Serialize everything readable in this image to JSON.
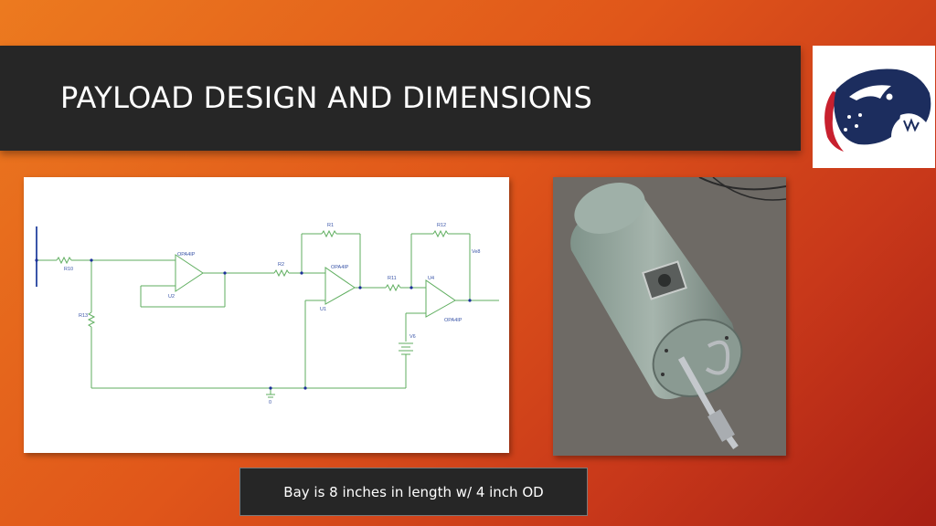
{
  "slide": {
    "title": "PAYLOAD DESIGN AND DIMENSIONS",
    "caption": "Bay is 8 inches in length w/ 4 inch OD"
  },
  "logo": {
    "icon": "jaguar-logo-icon",
    "colors": {
      "navy": "#1c2d5e",
      "red": "#c8202e"
    }
  },
  "schematic": {
    "labels": {
      "r10": "R10",
      "r13": "R13",
      "u2_part": "OPA4IP",
      "u2": "U2",
      "r2": "R2",
      "r1": "R1",
      "u1_part": "OPA4IP",
      "u1": "U1",
      "r12": "R12",
      "r11": "R11",
      "u4": "U4",
      "u4_part": "OPA4IP",
      "out": "Ve8",
      "v6": "V6",
      "gnd": "0"
    },
    "wire_color": "#5fae5f",
    "label_color": "#3a55a8"
  },
  "photo": {
    "subject": "payload-bay-cylinder"
  }
}
